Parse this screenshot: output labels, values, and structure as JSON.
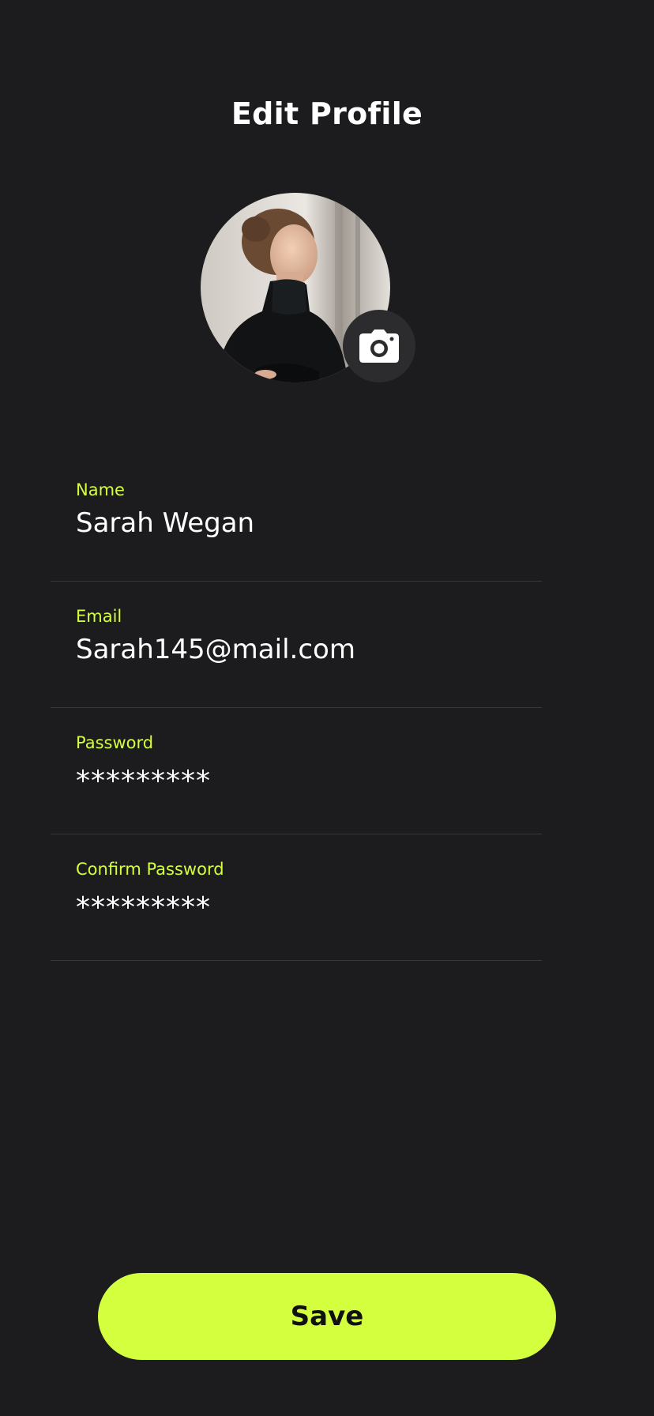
{
  "header": {
    "title": "Edit Profile"
  },
  "profile": {
    "avatar_icon": "person-photo",
    "camera_icon": "camera-icon"
  },
  "form": {
    "fields": [
      {
        "label": "Name",
        "value": "Sarah Wegan"
      },
      {
        "label": "Email",
        "value": "Sarah145@mail.com"
      },
      {
        "label": "Password",
        "value": "*********"
      },
      {
        "label": "Confirm Password",
        "value": "*********"
      }
    ]
  },
  "actions": {
    "save_label": "Save"
  },
  "colors": {
    "background": "#1c1c1e",
    "accent": "#d4ff3f",
    "divider": "#38383a",
    "camera_button_bg": "#2c2c2e"
  }
}
